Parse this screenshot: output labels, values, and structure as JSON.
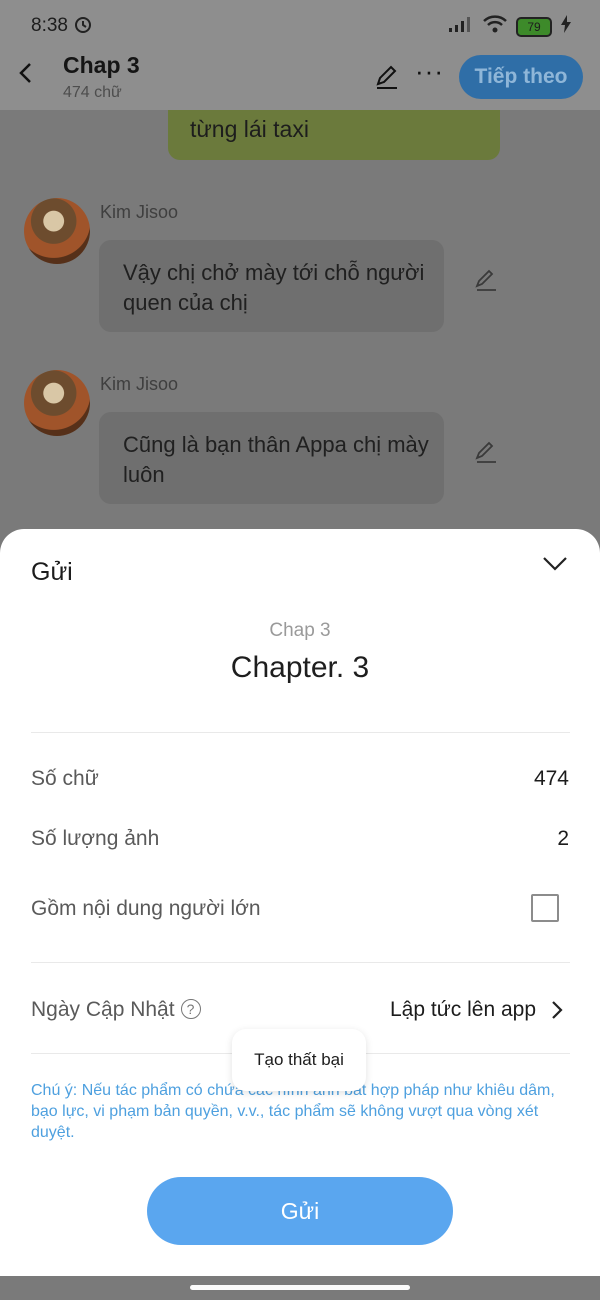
{
  "status_bar": {
    "time": "8:38",
    "battery_level": "79"
  },
  "header": {
    "title": "Chap 3",
    "subtitle": "474 chữ",
    "next_label": "Tiếp theo"
  },
  "chat": {
    "partial_bubble_text": "từng lái taxi",
    "messages": [
      {
        "sender": "Kim Jisoo",
        "text": "Vậy chị chở mày tới chỗ người quen của chị"
      },
      {
        "sender": "Kim Jisoo",
        "text": "Cũng là bạn thân Appa chị mày luôn"
      }
    ]
  },
  "sheet": {
    "title": "Gửi",
    "chapter_small": "Chap 3",
    "chapter_big": "Chapter. 3",
    "word_count_label": "Số chữ",
    "word_count_value": "474",
    "image_count_label": "Số lượng ảnh",
    "image_count_value": "2",
    "adult_content_label": "Gồm nội dung người lớn",
    "adult_content_checked": false,
    "update_date_label": "Ngày Cập Nhật",
    "update_date_value": "Lập tức lên app",
    "note": "Chú ý: Nếu tác phẩm có chứa các hình ảnh bất hợp pháp như khiêu dâm, bạo lực, vi phạm bản quyền, v.v., tác phẩm sẽ không vượt qua vòng xét duyệt.",
    "send_label": "Gửi"
  },
  "toast": {
    "text": "Tạo thất bại"
  },
  "colors": {
    "accent": "#5aa6ef",
    "note": "#4ea0df"
  }
}
